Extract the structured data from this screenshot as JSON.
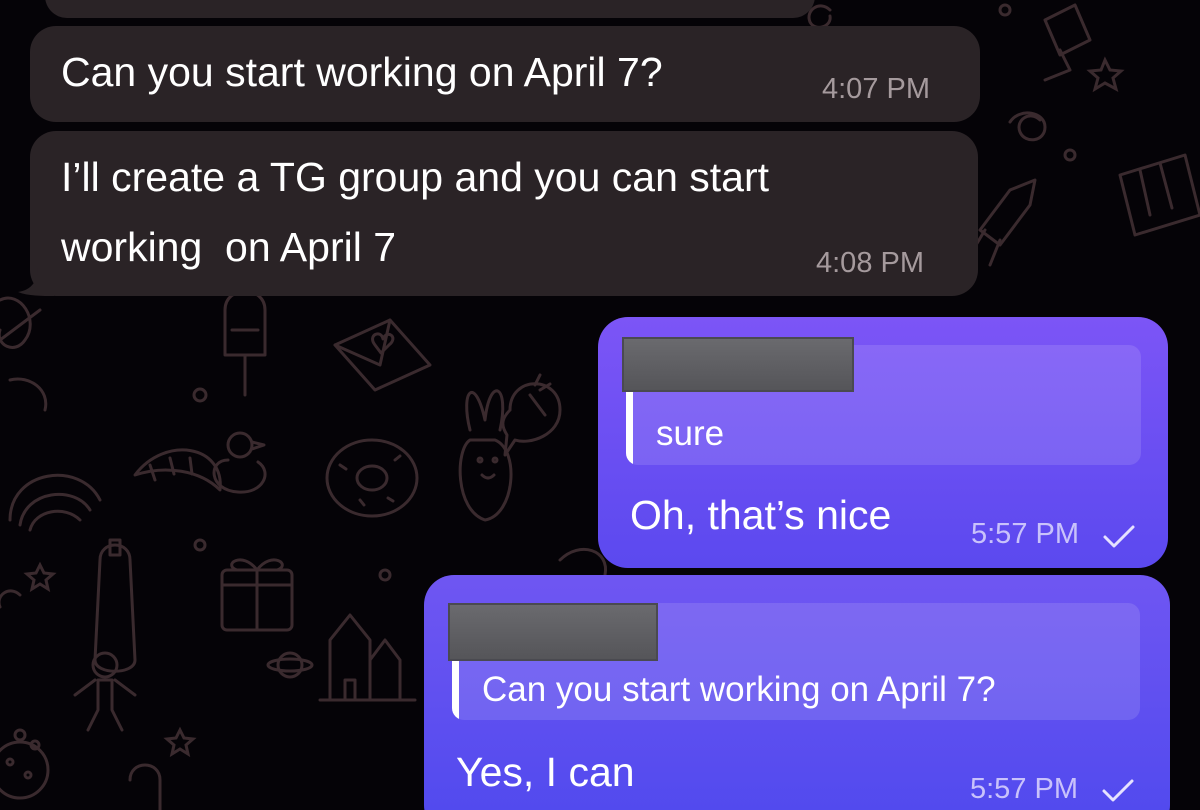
{
  "messages": [
    {
      "direction": "incoming",
      "text_lines": [
        "Can you start working on April 7?"
      ],
      "time": "4:07 PM"
    },
    {
      "direction": "incoming",
      "text_lines": [
        "I’ll create a TG group and you can start",
        "working  on April 7"
      ],
      "time": "4:08 PM"
    },
    {
      "direction": "outgoing",
      "reply_quote": "sure",
      "text": "Oh, that’s nice",
      "time": "5:57 PM",
      "status_icon": "single-check-icon"
    },
    {
      "direction": "outgoing",
      "reply_quote": "Can you start working on April 7?",
      "text": "Yes, I can",
      "time": "5:57 PM",
      "status_icon": "single-check-icon"
    }
  ],
  "colors": {
    "incoming_bubble": "#2a2326",
    "outgoing_bubble_top": "#7c55f6",
    "outgoing_bubble_bottom": "#4f49ee",
    "wallpaper_background": "#050307",
    "wallpaper_doodle": "#3a2a2e"
  }
}
